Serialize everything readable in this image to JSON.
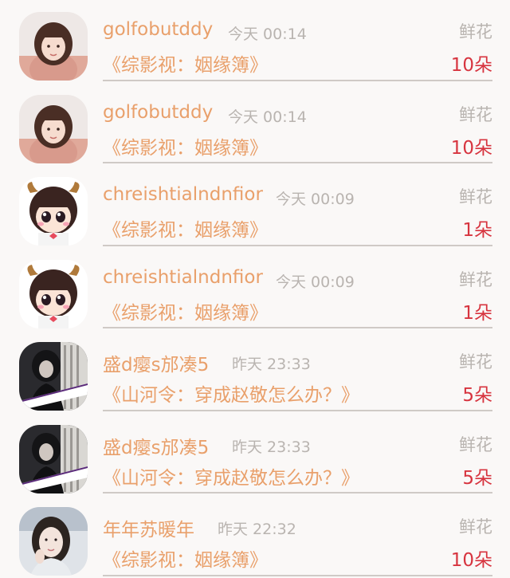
{
  "flower_label": "鲜花",
  "rows": [
    {
      "name": "golfobutddy",
      "time": "今天 00:14",
      "book": "《综影视：姻缘簿》",
      "count": "10朵",
      "avatar": "girl-pink-sweater-avatar"
    },
    {
      "name": "golfobutddy",
      "time": "今天 00:14",
      "book": "《综影视：姻缘簿》",
      "count": "10朵",
      "avatar": "girl-pink-sweater-avatar"
    },
    {
      "name": "chreishtialndnfior",
      "time": "今天 00:09",
      "book": "《综影视：姻缘簿》",
      "count": "1朵",
      "avatar": "cartoon-cow-girl-avatar"
    },
    {
      "name": "chreishtialndnfior",
      "time": "今天 00:09",
      "book": "《综影视：姻缘簿》",
      "count": "1朵",
      "avatar": "cartoon-cow-girl-avatar"
    },
    {
      "name": "盛d瘿s邡凑5",
      "time": "昨天 23:33",
      "book": "《山河令：穿成赵敬怎么办？》",
      "count": "5朵",
      "avatar": "dark-photo-avatar"
    },
    {
      "name": "盛d瘿s邡凑5",
      "time": "昨天 23:33",
      "book": "《山河令：穿成赵敬怎么办？》",
      "count": "5朵",
      "avatar": "dark-photo-avatar"
    },
    {
      "name": "年年苏暖年",
      "time": "昨天 22:32",
      "book": "《综影视：姻缘簿》",
      "count": "10朵",
      "avatar": "woman-portrait-avatar"
    }
  ],
  "colors": {
    "name": "#e9a06b",
    "muted": "#b9b4b0",
    "count": "#d7343f",
    "background": "#faf8f7"
  }
}
